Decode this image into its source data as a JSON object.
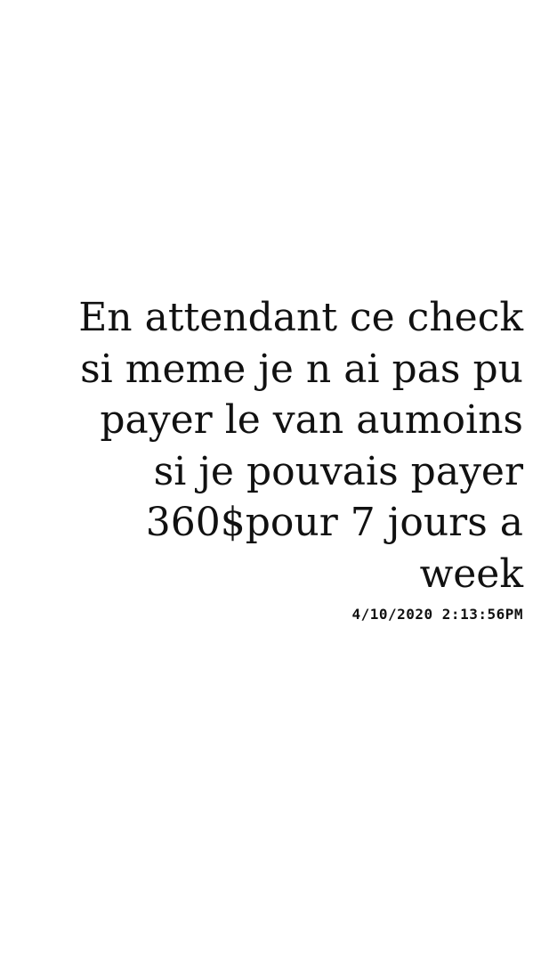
{
  "note": {
    "lines": [
      "En attendant ce check",
      "si meme je n ai pas pu",
      "payer le van aumoins",
      "si je pouvais payer",
      "360$pour 7 jours a",
      "week"
    ],
    "timestamp": "4/10/2020 2:13:56PM"
  }
}
